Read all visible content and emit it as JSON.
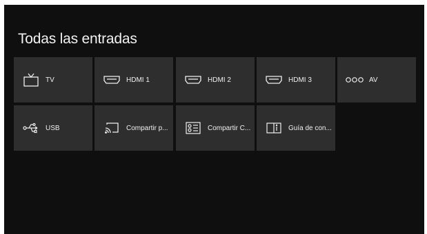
{
  "page": {
    "title": "Todas las entradas"
  },
  "inputs": [
    {
      "label": "TV",
      "icon": "tv-icon"
    },
    {
      "label": "HDMI 1",
      "icon": "hdmi-icon"
    },
    {
      "label": "HDMI 2",
      "icon": "hdmi-icon"
    },
    {
      "label": "HDMI 3",
      "icon": "hdmi-icon"
    },
    {
      "label": "AV",
      "icon": "av-connector-icon"
    },
    {
      "label": "USB",
      "icon": "usb-icon"
    },
    {
      "label": "Compartir p...",
      "icon": "screen-cast-icon"
    },
    {
      "label": "Compartir C...",
      "icon": "media-share-icon"
    },
    {
      "label": "Guía de con...",
      "icon": "guide-book-icon"
    }
  ],
  "colors": {
    "background": "#0f0f0f",
    "tile": "#2e2e2e",
    "text": "#f0f0f0"
  }
}
